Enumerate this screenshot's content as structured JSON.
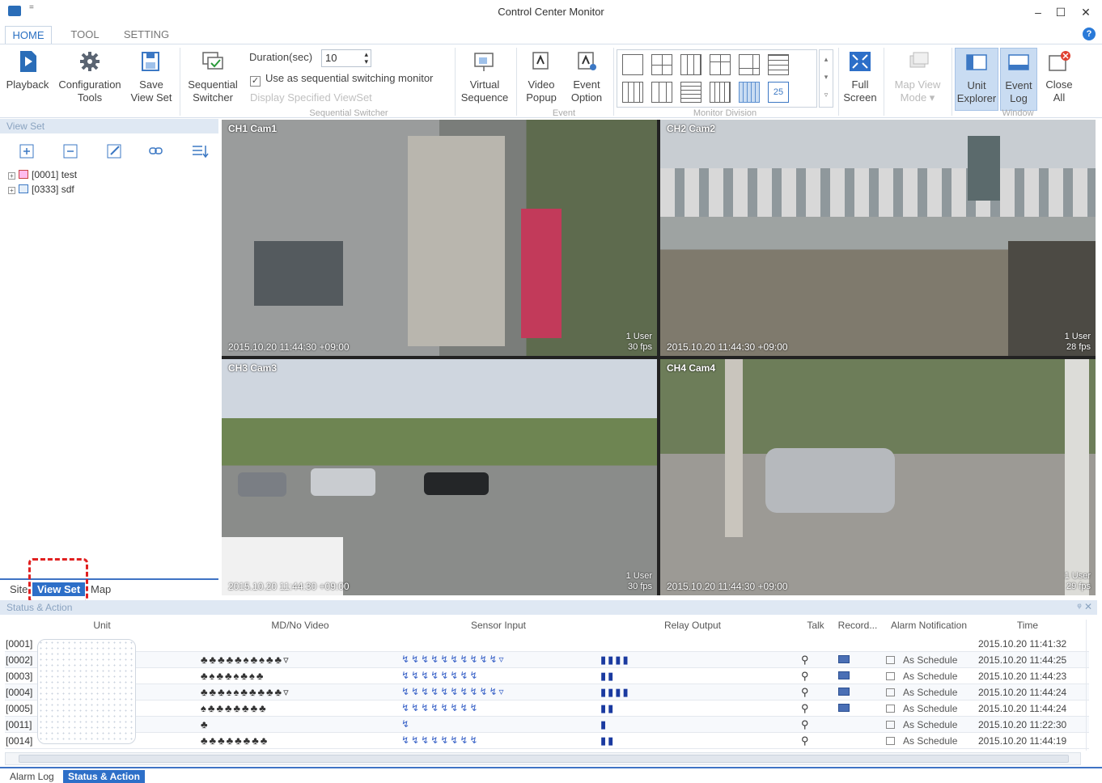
{
  "window": {
    "title": "Control Center Monitor",
    "minimize": "–",
    "maximize": "☐",
    "close": "✕",
    "qa": "="
  },
  "menu_tabs": [
    "HOME",
    "TOOL",
    "SETTING"
  ],
  "ribbon": {
    "playback": {
      "l1": "Playback",
      "l2": ""
    },
    "configuration": {
      "l1": "Configuration",
      "l2": "Tools"
    },
    "save_view_set": {
      "l1": "Save",
      "l2": "View Set"
    },
    "sequential_switcher_btn": {
      "l1": "Sequential",
      "l2": "Switcher"
    },
    "duration_label": "Duration(sec)",
    "duration_value": "10",
    "use_seq_label": "Use as sequential switching monitor",
    "use_seq_checked": true,
    "display_viewset_label": "Display Specified ViewSet",
    "seq_group_label": "Sequential Switcher",
    "virtual_sequence": {
      "l1": "Virtual",
      "l2": "Sequence"
    },
    "video_popup": {
      "l1": "Video",
      "l2": "Popup"
    },
    "event_option": {
      "l1": "Event",
      "l2": "Option"
    },
    "event_group_label": "Event",
    "monitor_division_label": "Monitor Division",
    "full_screen": {
      "l1": "Full",
      "l2": "Screen"
    },
    "map_view_mode": {
      "l1": "Map View",
      "l2": "Mode ▾"
    },
    "unit_explorer": {
      "l1": "Unit",
      "l2": "Explorer"
    },
    "event_log": {
      "l1": "Event",
      "l2": "Log"
    },
    "close_all": {
      "l1": "Close",
      "l2": "All"
    },
    "window_group_label": "Window"
  },
  "view_set": {
    "title": "View Set",
    "tree": [
      {
        "id": "[0001]",
        "name": "test"
      },
      {
        "id": "[0333]",
        "name": "sdf"
      }
    ],
    "tabs": [
      "Site",
      "View Set",
      "Map"
    ],
    "active_tab": "View Set"
  },
  "cameras": [
    {
      "label": "CH1 Cam1",
      "timestamp": "2015.10.20 11:44:30 +09:00",
      "fps": "1 User\n30 fps"
    },
    {
      "label": "CH2 Cam2",
      "timestamp": "2015.10.20 11:44:30 +09:00",
      "fps": "1 User\n28 fps"
    },
    {
      "label": "CH3 Cam3",
      "timestamp": "2015.10.20 11:44:30 +09:00",
      "fps": "1 User\n30 fps"
    },
    {
      "label": "CH4 Cam4",
      "timestamp": "2015.10.20 11:44:30 +09:00",
      "fps": "1 User\n29 fps"
    }
  ],
  "status": {
    "title": "Status & Action",
    "controls": "ᵠ ✕",
    "columns": [
      "Unit",
      "MD/No Video",
      "Sensor Input",
      "Relay Output",
      "Talk",
      "Record...",
      "Alarm Notification",
      "Time"
    ],
    "rows": [
      {
        "unit": "[0001]",
        "md": "",
        "sensor": "",
        "relay": "",
        "talk": false,
        "rec": false,
        "alarm": "",
        "time": "2015.10.20 11:41:32"
      },
      {
        "unit": "[0002]",
        "md": "♣♣♣♣♣♠♣♠♣♣▿",
        "sensor": "↯↯↯↯↯↯↯↯↯↯▿",
        "relay": "▮▮▮▮",
        "talk": true,
        "rec": true,
        "alarm": "As Schedule",
        "time": "2015.10.20 11:44:25"
      },
      {
        "unit": "[0003]",
        "md": "♣♠♣♣♠♣♠♣",
        "sensor": "↯↯↯↯↯↯↯↯",
        "relay": "▮▮",
        "talk": true,
        "rec": true,
        "alarm": "As Schedule",
        "time": "2015.10.20 11:44:23"
      },
      {
        "unit": "[0004]",
        "md": "♣♣♣♠♠♣♣♣♣♣▿",
        "sensor": "↯↯↯↯↯↯↯↯↯↯▿",
        "relay": "▮▮▮▮",
        "talk": true,
        "rec": true,
        "alarm": "As Schedule",
        "time": "2015.10.20 11:44:24"
      },
      {
        "unit": "[0005]",
        "md": "♠♣♣♣♣♣♣♣",
        "sensor": "↯↯↯↯↯↯↯↯",
        "relay": "▮▮",
        "talk": true,
        "rec": true,
        "alarm": "As Schedule",
        "time": "2015.10.20 11:44:24"
      },
      {
        "unit": "[0011]",
        "md": "♣",
        "sensor": "↯",
        "relay": "▮",
        "talk": true,
        "rec": false,
        "alarm": "As Schedule",
        "time": "2015.10.20 11:22:30"
      },
      {
        "unit": "[0014]",
        "md": "♣♣♣♣♣♣♣♣",
        "sensor": "↯↯↯↯↯↯↯↯",
        "relay": "▮▮",
        "talk": true,
        "rec": false,
        "alarm": "As Schedule",
        "time": "2015.10.20 11:44:19"
      }
    ]
  },
  "footer_tabs": [
    "Alarm Log",
    "Status & Action"
  ],
  "icons": {
    "playback": "play-icon",
    "configuration": "gear-icon",
    "save": "save-icon",
    "close_all": "close-all-icon"
  },
  "colors": {
    "accent": "#2d6fc8",
    "highlight": "#e02020",
    "panel_head": "#dfe8f3"
  }
}
